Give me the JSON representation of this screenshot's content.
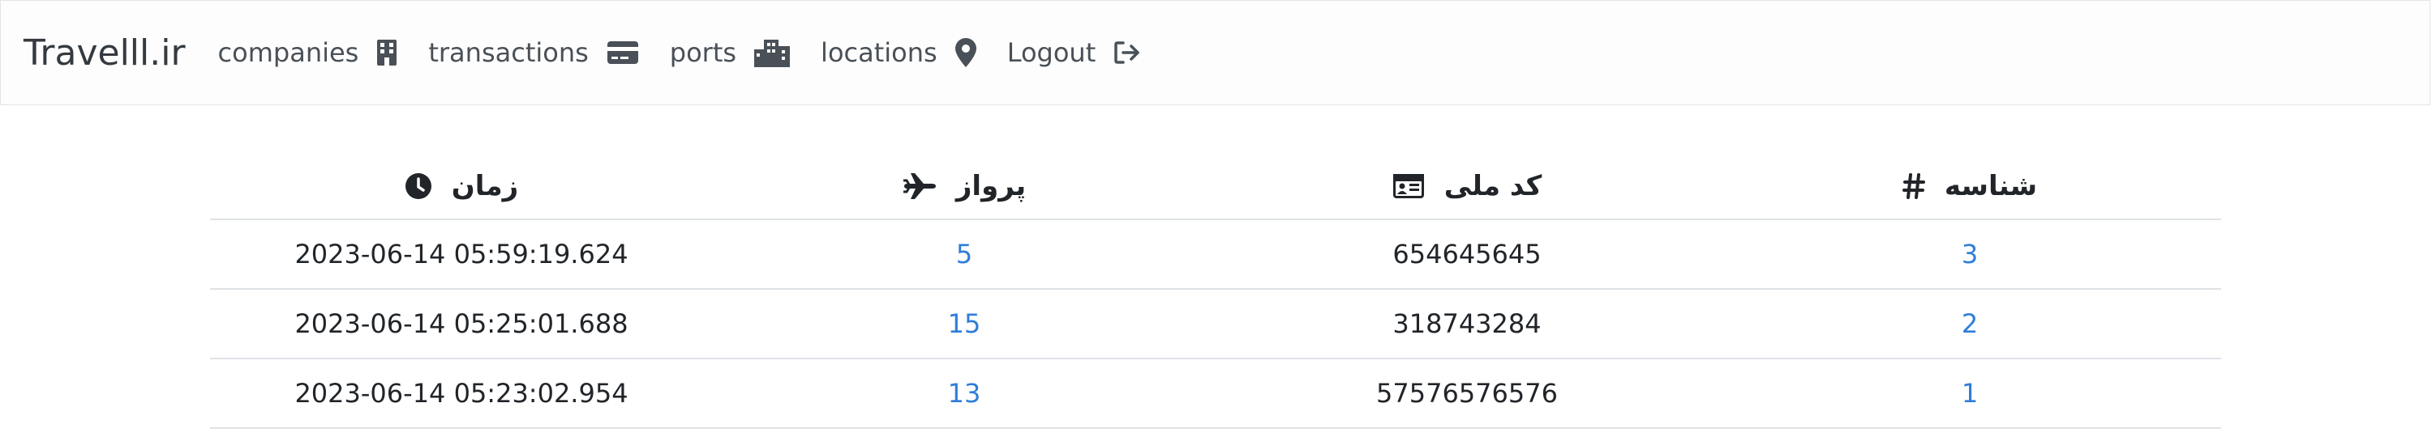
{
  "brand": "Travelll.ir",
  "nav": {
    "companies": "companies",
    "transactions": "transactions",
    "ports": "ports",
    "locations": "locations",
    "logout": "Logout"
  },
  "table": {
    "headers": {
      "id": "شناسه",
      "national_code": "کد ملی",
      "flight": "پرواز",
      "time": "زمان"
    },
    "rows": [
      {
        "id": "3",
        "national_code": "654645645",
        "flight": "5",
        "time": "2023-06-14 05:59:19.624"
      },
      {
        "id": "2",
        "national_code": "318743284",
        "flight": "15",
        "time": "2023-06-14 05:25:01.688"
      },
      {
        "id": "1",
        "national_code": "57576576576",
        "flight": "13",
        "time": "2023-06-14 05:23:02.954"
      }
    ]
  },
  "colors": {
    "link": "#2f7ed8",
    "text": "#212529",
    "border": "#dee2e6"
  }
}
